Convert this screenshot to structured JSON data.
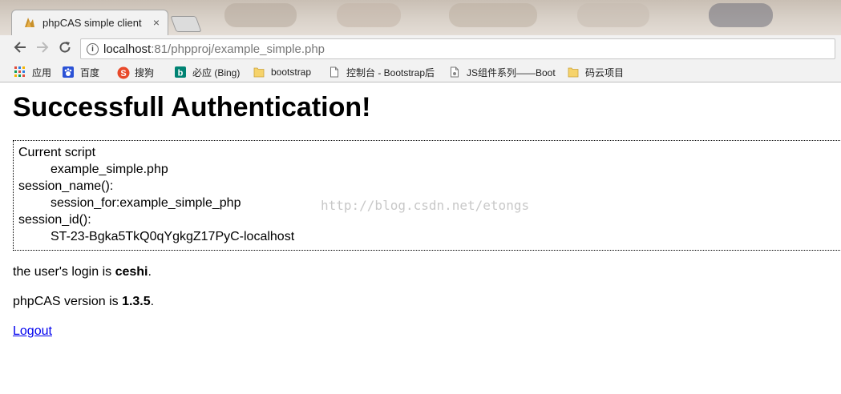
{
  "browser": {
    "tab_title": "phpCAS simple client",
    "tab_close": "×",
    "url_host": "localhost",
    "url_rest": ":81/phpproj/example_simple.php",
    "bookmarks": [
      {
        "label": "应用",
        "icon": "apps-grid-icon"
      },
      {
        "label": "百度",
        "icon": "baidu-paw-icon"
      },
      {
        "label": "搜狗",
        "icon": "sogou-icon"
      },
      {
        "label": "必应 (Bing)",
        "icon": "bing-icon"
      },
      {
        "label": "bootstrap",
        "icon": "folder-icon"
      },
      {
        "label": "控制台 - Bootstrap后",
        "icon": "page-icon"
      },
      {
        "label": "JS组件系列——Boot",
        "icon": "page-icon"
      },
      {
        "label": "码云项目",
        "icon": "folder-icon"
      }
    ]
  },
  "page": {
    "heading": "Successfull Authentication!",
    "dump": {
      "current_script_label": "Current script",
      "current_script_value": "example_simple.php",
      "session_name_label": "session_name():",
      "session_name_value": "session_for:example_simple_php",
      "session_id_label": "session_id():",
      "session_id_value": "ST-23-Bgka5TkQ0qYgkgZ17PyC-localhost"
    },
    "watermark": "http://blog.csdn.net/etongs",
    "login_prefix": "the user's login is ",
    "login_user": "ceshi",
    "login_suffix": ".",
    "version_prefix": "phpCAS version is ",
    "version_value": "1.3.5",
    "version_suffix": ".",
    "logout_label": "Logout"
  },
  "colors": {
    "link": "#0000ee",
    "chrome_bg": "#f2f2f2"
  }
}
